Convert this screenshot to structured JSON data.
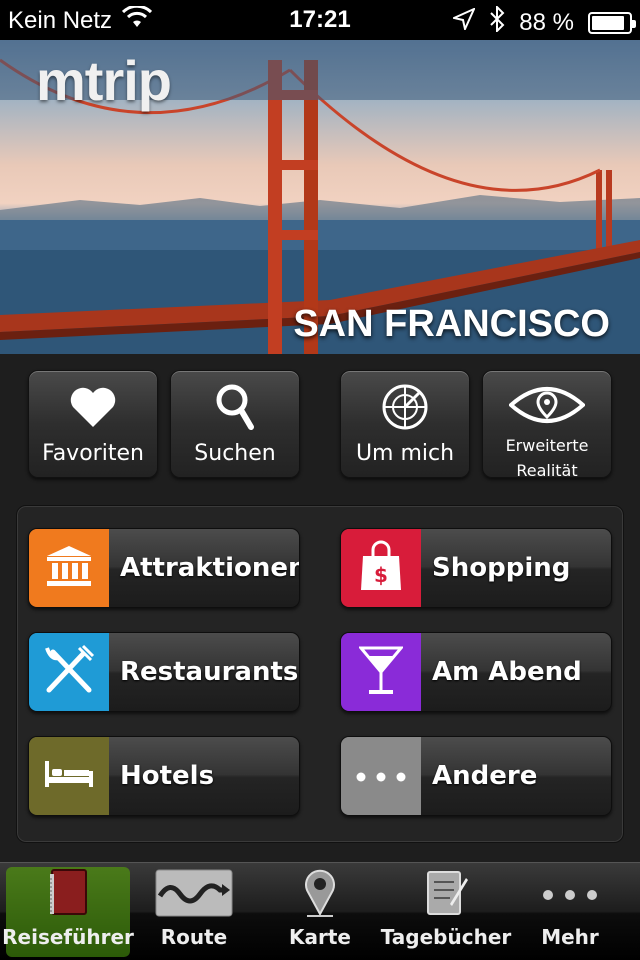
{
  "status_bar": {
    "carrier": "Kein Netz",
    "time": "17:21",
    "battery_percent": "88 %",
    "battery_level": 0.88
  },
  "hero": {
    "logo": "mtrip",
    "city": "SAN FRANCISCO"
  },
  "quick_actions": [
    {
      "label": "Favoriten",
      "icon": "heart-icon"
    },
    {
      "label": "Suchen",
      "icon": "search-icon"
    },
    {
      "label": "Um mich",
      "icon": "radar-icon"
    },
    {
      "label_line1": "Erweiterte",
      "label_line2": "Realität",
      "icon": "eye-icon"
    }
  ],
  "categories": [
    {
      "label": "Attraktionen",
      "icon": "landmark-icon",
      "color": "#f07a1e"
    },
    {
      "label": "Shopping",
      "icon": "shopping-bag-icon",
      "color": "#d81c3a"
    },
    {
      "label": "Restaurants",
      "icon": "cutlery-icon",
      "color": "#1f9bd6"
    },
    {
      "label": "Am Abend",
      "icon": "cocktail-icon",
      "color": "#8a2bd8"
    },
    {
      "label": "Hotels",
      "icon": "bed-icon",
      "color": "#6e6a2a"
    },
    {
      "label": "Andere",
      "icon": "more-icon",
      "color": "#8a8a8a"
    }
  ],
  "tabs": [
    {
      "label": "Reiseführer",
      "icon": "book-icon",
      "active": true
    },
    {
      "label": "Route",
      "icon": "route-icon",
      "active": false
    },
    {
      "label": "Karte",
      "icon": "map-pin-icon",
      "active": false
    },
    {
      "label": "Tagebücher",
      "icon": "notebook-icon",
      "active": false
    },
    {
      "label": "Mehr",
      "icon": "more-icon",
      "active": false
    }
  ]
}
